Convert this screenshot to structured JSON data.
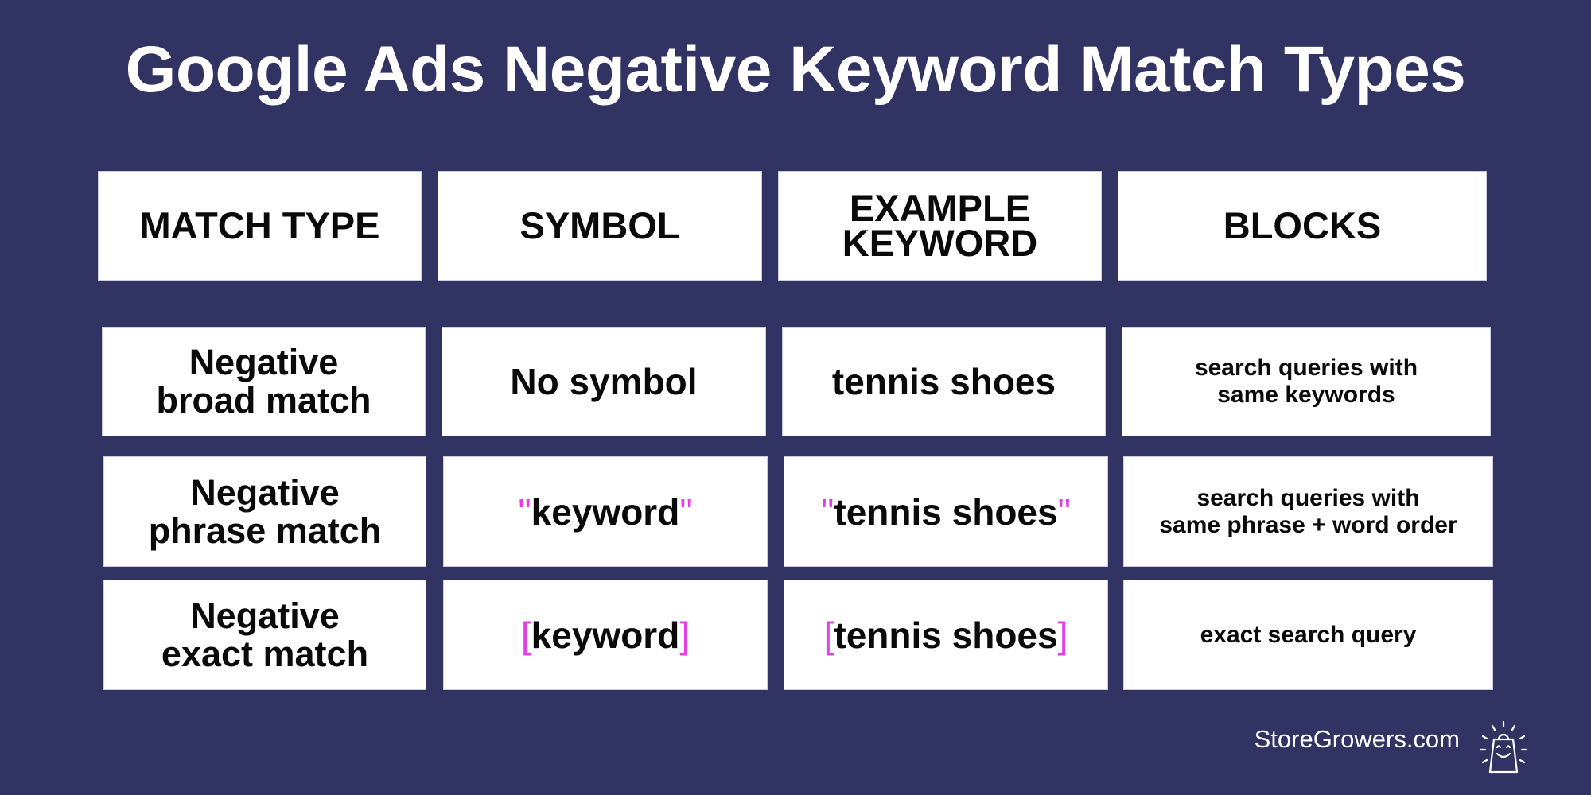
{
  "title": "Google Ads Negative Keyword Match Types",
  "headers": [
    "MATCH TYPE",
    "SYMBOL",
    "EXAMPLE KEYWORD",
    "BLOCKS"
  ],
  "header_lines": {
    "example_keyword": [
      "EXAMPLE",
      "KEYWORD"
    ]
  },
  "rows": [
    {
      "match_type": [
        "Negative",
        "broad match"
      ],
      "symbol": {
        "open": "",
        "text": "No symbol",
        "close": ""
      },
      "example": {
        "open": "",
        "text": "tennis shoes",
        "close": ""
      },
      "blocks": [
        "search queries with",
        "same keywords"
      ]
    },
    {
      "match_type": [
        "Negative",
        "phrase match"
      ],
      "symbol": {
        "open": "\"",
        "text": "keyword",
        "close": "\""
      },
      "example": {
        "open": "\"",
        "text": "tennis shoes",
        "close": "\""
      },
      "blocks": [
        "search queries with",
        "same phrase + word order"
      ]
    },
    {
      "match_type": [
        "Negative",
        "exact match"
      ],
      "symbol": {
        "open": "[",
        "text": "keyword",
        "close": "]"
      },
      "example": {
        "open": "[",
        "text": "tennis shoes",
        "close": "]"
      },
      "blocks": [
        "exact search query"
      ]
    }
  ],
  "footer": {
    "brand": "StoreGrowers.com",
    "logo_icon": "shopping-bag-smile-icon"
  },
  "colors": {
    "background": "#313463",
    "accent": "#e63ee6",
    "cell": "#ffffff",
    "text": "#0a0a0a"
  }
}
